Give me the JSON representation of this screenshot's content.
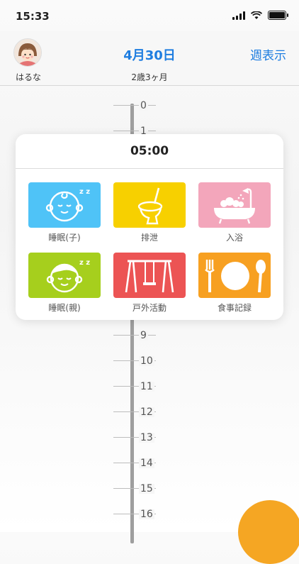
{
  "status_bar": {
    "time": "15:33"
  },
  "header": {
    "child_name": "はるな",
    "date_title": "4月30日",
    "age": "2歳3ヶ月",
    "week_button": "週表示"
  },
  "timeline": {
    "hour_labels": [
      "0",
      "1",
      "9",
      "10",
      "11",
      "12",
      "13",
      "14",
      "15",
      "16"
    ]
  },
  "popup": {
    "time": "05:00",
    "actions": [
      {
        "label": "睡眠(子)",
        "color": "#4fc3f7",
        "icon": "sleeping-baby-icon"
      },
      {
        "label": "排泄",
        "color": "#f7d000",
        "icon": "toilet-icon"
      },
      {
        "label": "入浴",
        "color": "#f3a6bb",
        "icon": "bathtub-icon"
      },
      {
        "label": "睡眠(親)",
        "color": "#a6cf1d",
        "icon": "sleeping-parent-icon"
      },
      {
        "label": "戸外活動",
        "color": "#ec5454",
        "icon": "swing-icon"
      },
      {
        "label": "食事記録",
        "color": "#f7a021",
        "icon": "meal-icon"
      }
    ]
  },
  "colors": {
    "accent": "#1e7de0",
    "fab": "#f5a623"
  }
}
